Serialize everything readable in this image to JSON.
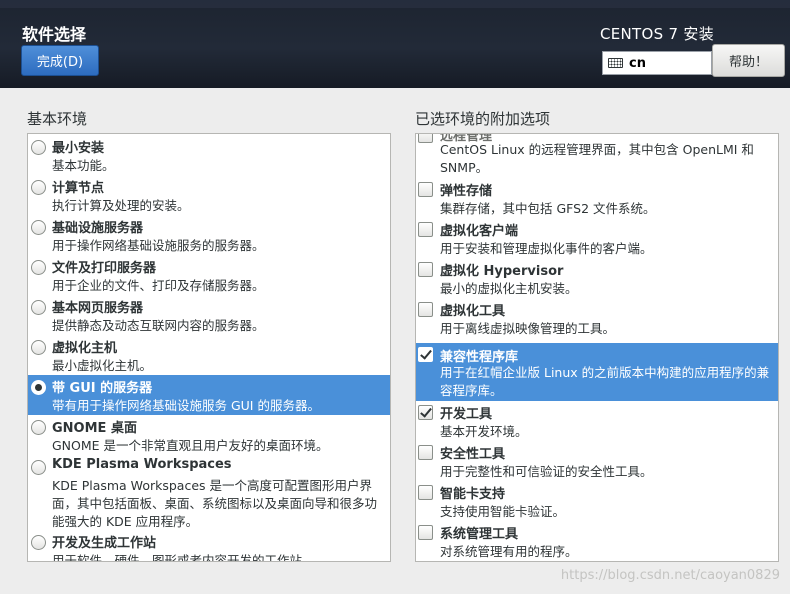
{
  "header": {
    "title": "软件选择",
    "done_button": "完成(D)",
    "product": "CENTOS 7 安装",
    "keyboard_layout": "cn",
    "help_button": "帮助！"
  },
  "left": {
    "heading": "基本环境",
    "selected_index": 6,
    "items": [
      {
        "name": "最小安装",
        "desc": "基本功能。"
      },
      {
        "name": "计算节点",
        "desc": "执行计算及处理的安装。"
      },
      {
        "name": "基础设施服务器",
        "desc": "用于操作网络基础设施服务的服务器。"
      },
      {
        "name": "文件及打印服务器",
        "desc": "用于企业的文件、打印及存储服务器。"
      },
      {
        "name": "基本网页服务器",
        "desc": "提供静态及动态互联网内容的服务器。"
      },
      {
        "name": "虚拟化主机",
        "desc": "最小虚拟化主机。"
      },
      {
        "name": "带 GUI 的服务器",
        "desc": "带有用于操作网络基础设施服务 GUI 的服务器。"
      },
      {
        "name": "GNOME 桌面",
        "desc": "GNOME 是一个非常直观且用户友好的桌面环境。"
      },
      {
        "name": "KDE Plasma Workspaces",
        "desc": "KDE Plasma Workspaces 是一个高度可配置图形用户界面，其中包括面板、桌面、系统图标以及桌面向导和很多功能强大的 KDE 应用程序。"
      },
      {
        "name": "开发及生成工作站",
        "desc": "用于软件、硬件、图形或者内容开发的工作站。"
      }
    ]
  },
  "right": {
    "heading": "已选环境的附加选项",
    "items": [
      {
        "name": "远程管理",
        "desc": "CentOS Linux 的远程管理界面，其中包含 OpenLMI 和 SNMP。",
        "checked": false
      },
      {
        "name": "弹性存储",
        "desc": "集群存储，其中包括 GFS2 文件系统。",
        "checked": false
      },
      {
        "name": "虚拟化客户端",
        "desc": "用于安装和管理虚拟化事件的客户端。",
        "checked": false
      },
      {
        "name": "虚拟化 Hypervisor",
        "desc": "最小的虚拟化主机安装。",
        "checked": false
      },
      {
        "name": "虚拟化工具",
        "desc": "用于离线虚拟映像管理的工具。",
        "checked": false
      },
      {
        "name": "兼容性程序库",
        "desc": "用于在红帽企业版 Linux 的之前版本中构建的应用程序的兼容程序库。",
        "checked": true
      },
      {
        "name": "开发工具",
        "desc": "基本开发环境。",
        "checked": true
      },
      {
        "name": "安全性工具",
        "desc": "用于完整性和可信验证的安全性工具。",
        "checked": false
      },
      {
        "name": "智能卡支持",
        "desc": "支持使用智能卡验证。",
        "checked": false
      },
      {
        "name": "系统管理工具",
        "desc": "对系统管理有用的程序。",
        "checked": false
      }
    ]
  },
  "watermark": "https://blog.csdn.net/caoyan0829"
}
